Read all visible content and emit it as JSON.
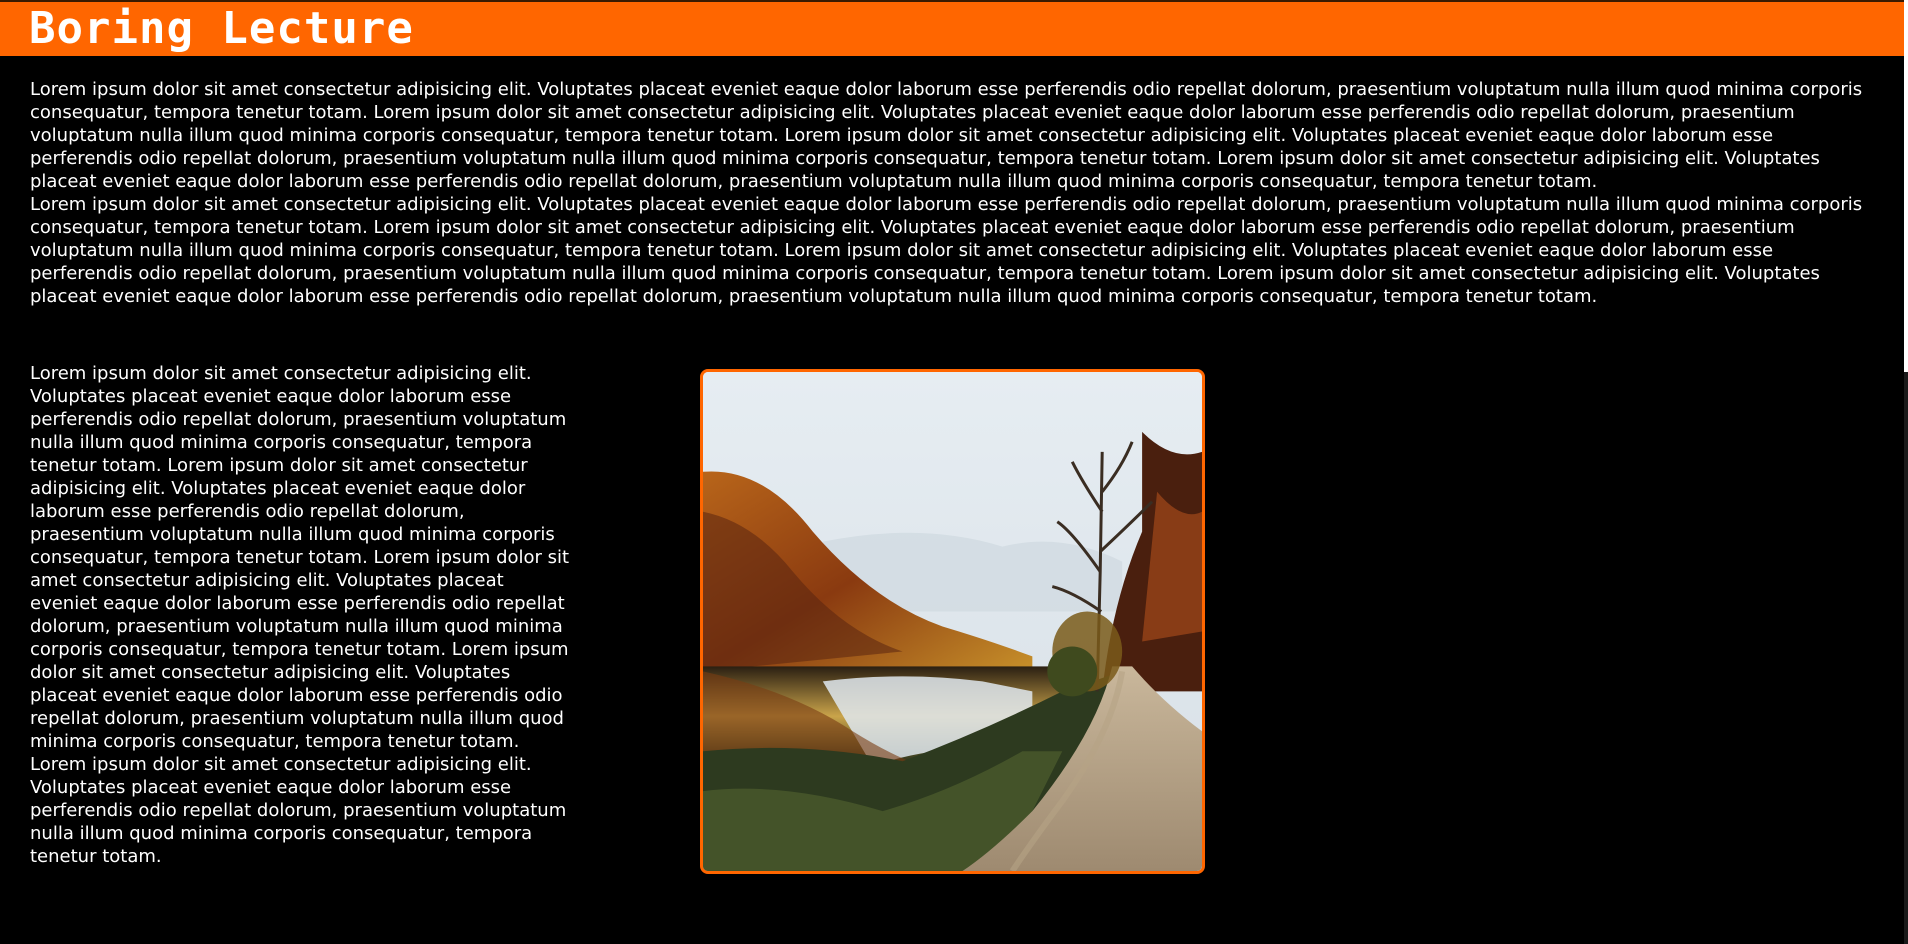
{
  "header": {
    "title": "Boring Lecture"
  },
  "intro": {
    "paragraphs": [
      "Lorem ipsum dolor sit amet consectetur adipisicing elit. Voluptates placeat eveniet eaque dolor laborum esse perferendis odio repellat dolorum, praesentium voluptatum nulla illum quod minima corporis consequatur, tempora tenetur totam. Lorem ipsum dolor sit amet consectetur adipisicing elit. Voluptates placeat eveniet eaque dolor laborum esse perferendis odio repellat dolorum, praesentium voluptatum nulla illum quod minima corporis consequatur, tempora tenetur totam. Lorem ipsum dolor sit amet consectetur adipisicing elit. Voluptates placeat eveniet eaque dolor laborum esse perferendis odio repellat dolorum, praesentium voluptatum nulla illum quod minima corporis consequatur, tempora tenetur totam. Lorem ipsum dolor sit amet consectetur adipisicing elit. Voluptates placeat eveniet eaque dolor laborum esse perferendis odio repellat dolorum, praesentium voluptatum nulla illum quod minima corporis consequatur, tempora tenetur totam.",
      "Lorem ipsum dolor sit amet consectetur adipisicing elit. Voluptates placeat eveniet eaque dolor laborum esse perferendis odio repellat dolorum, praesentium voluptatum nulla illum quod minima corporis consequatur, tempora tenetur totam. Lorem ipsum dolor sit amet consectetur adipisicing elit. Voluptates placeat eveniet eaque dolor laborum esse perferendis odio repellat dolorum, praesentium voluptatum nulla illum quod minima corporis consequatur, tempora tenetur totam. Lorem ipsum dolor sit amet consectetur adipisicing elit. Voluptates placeat eveniet eaque dolor laborum esse perferendis odio repellat dolorum, praesentium voluptatum nulla illum quod minima corporis consequatur, tempora tenetur totam. Lorem ipsum dolor sit amet consectetur adipisicing elit. Voluptates placeat eveniet eaque dolor laborum esse perferendis odio repellat dolorum, praesentium voluptatum nulla illum quod minima corporis consequatur, tempora tenetur totam."
    ]
  },
  "side": {
    "text": "Lorem ipsum dolor sit amet consectetur adipisicing elit. Voluptates placeat eveniet eaque dolor laborum esse perferendis odio repellat dolorum, praesentium voluptatum nulla illum quod minima corporis consequatur, tempora tenetur totam. Lorem ipsum dolor sit amet consectetur adipisicing elit. Voluptates placeat eveniet eaque dolor laborum esse perferendis odio repellat dolorum, praesentium voluptatum nulla illum quod minima corporis consequatur, tempora tenetur totam. Lorem ipsum dolor sit amet consectetur adipisicing elit. Voluptates placeat eveniet eaque dolor laborum esse perferendis odio repellat dolorum, praesentium voluptatum nulla illum quod minima corporis consequatur, tempora tenetur totam. Lorem ipsum dolor sit amet consectetur adipisicing elit. Voluptates placeat eveniet eaque dolor laborum esse perferendis odio repellat dolorum, praesentium voluptatum nulla illum quod minima corporis consequatur, tempora tenetur totam. Lorem ipsum dolor sit amet consectetur adipisicing elit. Voluptates placeat eveniet eaque dolor laborum esse perferendis odio repellat dolorum, praesentium voluptatum nulla illum quod minima corporis consequatur, tempora tenetur totam."
  },
  "colors": {
    "accent": "#ff6600",
    "background": "#000000",
    "text": "#ffffff"
  }
}
